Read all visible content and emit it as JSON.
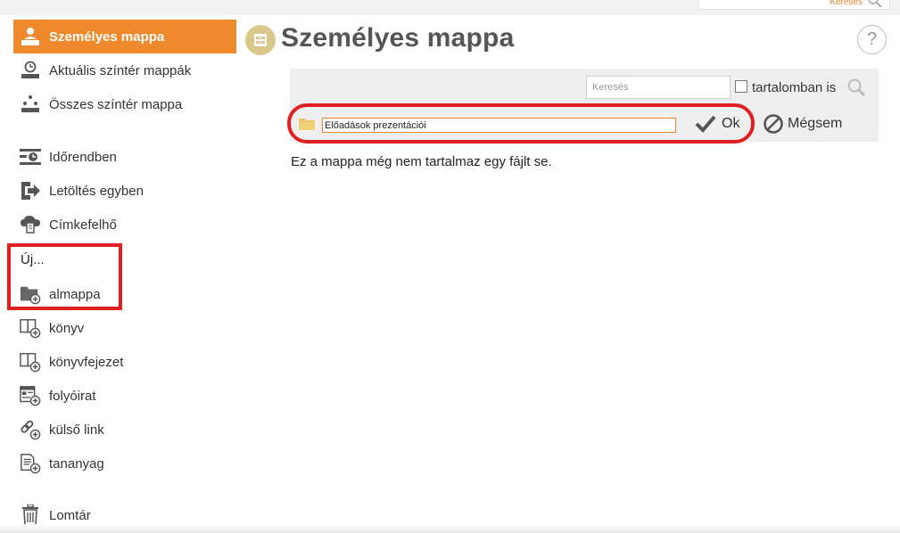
{
  "top_search": {
    "placeholder": "Keresés"
  },
  "sidebar": {
    "items": [
      {
        "label": "Személyes mappa",
        "icon": "personal-folder-icon",
        "active": true
      },
      {
        "label": "Aktuális színtér mappák",
        "icon": "clock-folder-icon"
      },
      {
        "label": "Összes színtér mappa",
        "icon": "network-folder-icon"
      },
      {
        "label": "Időrendben",
        "icon": "timeline-icon"
      },
      {
        "label": "Letöltés egyben",
        "icon": "download-export-icon"
      },
      {
        "label": "Címkefelhő",
        "icon": "tag-cloud-icon"
      }
    ],
    "new_label": "Új...",
    "new_items": [
      {
        "label": "almappa",
        "icon": "add-folder-icon"
      },
      {
        "label": "könyv",
        "icon": "add-book-icon"
      },
      {
        "label": "könyvfejezet",
        "icon": "add-chapter-icon"
      },
      {
        "label": "folyóirat",
        "icon": "add-journal-icon"
      },
      {
        "label": "külső link",
        "icon": "add-link-icon"
      },
      {
        "label": "tananyag",
        "icon": "add-material-icon"
      }
    ],
    "trash_label": "Lomtár"
  },
  "main": {
    "title": "Személyes mappa",
    "help": "?",
    "search": {
      "placeholder": "Keresés",
      "content_label": "tartalomban is"
    },
    "new_folder": {
      "value": "Előadások prezentációi",
      "ok_label": "Ok",
      "cancel_label": "Mégsem"
    },
    "empty_message": "Ez a mappa még nem tartalmaz egy fájlt se."
  },
  "colors": {
    "accent": "#f0892b",
    "highlight": "#e02020",
    "title_badge": "#d8c98a"
  }
}
